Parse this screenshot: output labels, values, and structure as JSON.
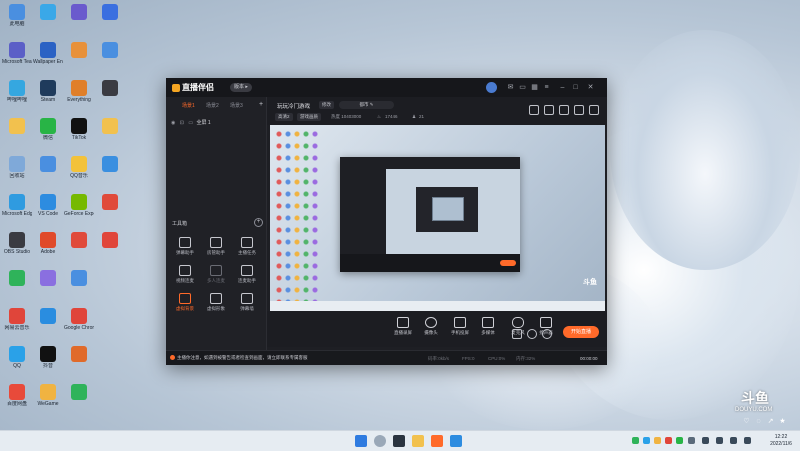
{
  "desktop": {
    "icons": [
      {
        "label": "此电脑",
        "color": "#4a8fe0"
      },
      {
        "label": "Microsoft Teams",
        "color": "#5b5fc7"
      },
      {
        "label": "哔哩哔哩",
        "color": "#35a7e0"
      },
      {
        "label": "",
        "color": "#f2c14e"
      },
      {
        "label": "回收站",
        "color": "#7fa9d9"
      },
      {
        "label": "Microsoft Edge",
        "color": "#2f9be0"
      },
      {
        "label": "OBS Studio",
        "color": "#3a3b42"
      },
      {
        "label": "",
        "color": "#2fb35a"
      },
      {
        "label": "网易云音乐",
        "color": "#e0453a"
      },
      {
        "label": "QQ",
        "color": "#2aa1e8"
      },
      {
        "label": "百度网盘",
        "color": "#e84a3a"
      },
      {
        "label": "",
        "color": "#3aa8e8"
      },
      {
        "label": "Wallpaper Engine",
        "color": "#2b62c4"
      },
      {
        "label": "Steam",
        "color": "#1f3b5c"
      },
      {
        "label": "微信",
        "color": "#28b446"
      },
      {
        "label": "",
        "color": "#4a8fe0"
      },
      {
        "label": "VS Code",
        "color": "#2d8ce0"
      },
      {
        "label": "Adobe",
        "color": "#e04a2a"
      },
      {
        "label": "",
        "color": "#8a6fe0"
      },
      {
        "label": "",
        "color": "#2a8de0"
      },
      {
        "label": "抖音",
        "color": "#111111"
      },
      {
        "label": "WeGame",
        "color": "#f0b341"
      },
      {
        "label": "",
        "color": "#6a5acd"
      },
      {
        "label": "",
        "color": "#e8913a"
      },
      {
        "label": "Everything",
        "color": "#e07f2a"
      },
      {
        "label": "TikTok",
        "color": "#111111"
      },
      {
        "label": "QQ音乐",
        "color": "#f3c23a"
      },
      {
        "label": "GeForce Experience",
        "color": "#76b900"
      },
      {
        "label": "",
        "color": "#e04a3a"
      },
      {
        "label": "",
        "color": "#4a8fe0"
      },
      {
        "label": "Google Chrome",
        "color": "#e0453a"
      },
      {
        "label": "",
        "color": "#e06a2a"
      },
      {
        "label": "",
        "color": "#2fb35a"
      },
      {
        "label": "",
        "color": "#3a6fe0"
      },
      {
        "label": "",
        "color": "#4a8fe0"
      },
      {
        "label": "",
        "color": "#3a3b42"
      },
      {
        "label": "",
        "color": "#f2c14e"
      },
      {
        "label": "",
        "color": "#3a8fe0"
      },
      {
        "label": "",
        "color": "#e04a3a"
      },
      {
        "label": "",
        "color": "#e0453a"
      }
    ]
  },
  "app": {
    "name": "直播伴侣",
    "version_btn": "版本 ▸",
    "scene_tabs": [
      "场景1",
      "场景2",
      "场景3"
    ],
    "scene_item": "全屏 1",
    "tools_heading": "工具箱",
    "tools": [
      {
        "label": "弹幕助手",
        "state": "normal"
      },
      {
        "label": "房管助手",
        "state": "normal"
      },
      {
        "label": "主播任务",
        "state": "normal"
      },
      {
        "label": "视频连麦",
        "state": "normal"
      },
      {
        "label": "多人连麦",
        "state": "dim"
      },
      {
        "label": "连麦助手",
        "state": "normal"
      },
      {
        "label": "虚拟背景",
        "state": "active"
      },
      {
        "label": "虚拟形象",
        "state": "normal"
      },
      {
        "label": "弹幕墙",
        "state": "normal"
      }
    ],
    "room_title": "玩玩冷门游戏",
    "edit_label": "修改",
    "anchor_label": "都市 ✎",
    "badges": [
      "高清2",
      "游戏画质"
    ],
    "stat_viewers": "热度 10403000",
    "stat_fans": "17446",
    "stat_other": "21",
    "controls": [
      "直播录屏",
      "摄像头",
      "手机投屏",
      "多媒体",
      "麦克风",
      "扬声器"
    ],
    "start_label": "开始直播",
    "notice": "主播你注意，如遇到被警告或者检查到画面，请立即联系专属客服",
    "status_items": [
      "码率:0kb/s",
      "FPS:0",
      "CPU:0%",
      "内存:32%"
    ],
    "timer": "00:00:00"
  },
  "watermark": {
    "logo": "斗鱼",
    "sub": "DOUYU.COM"
  },
  "taskbar": {
    "clock_time": "12:22",
    "clock_date": "2022/11/6"
  }
}
